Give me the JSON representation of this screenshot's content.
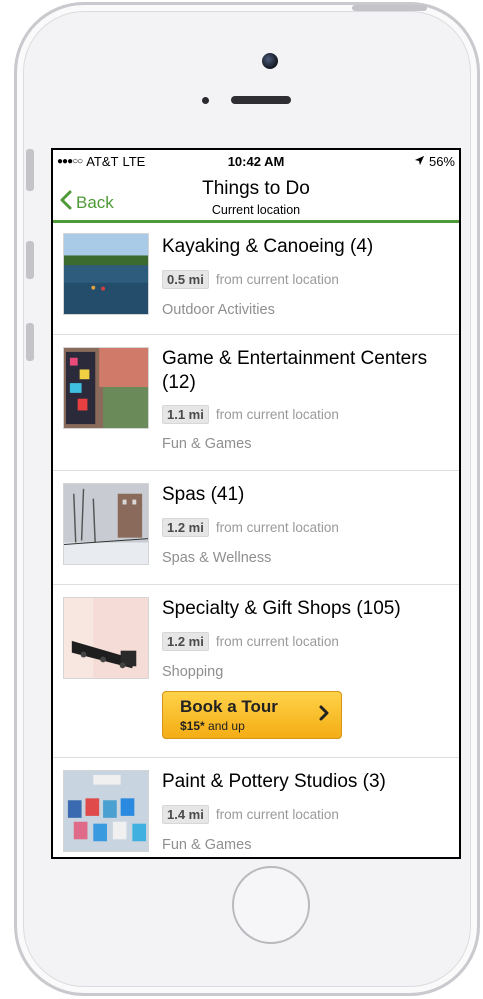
{
  "status_bar": {
    "signal": "●●●○○",
    "carrier": "AT&T",
    "network": "LTE",
    "time": "10:42 AM",
    "battery": "56%",
    "location_icon": "location-arrow-icon",
    "battery_icon": "battery-icon"
  },
  "nav": {
    "back_label": "Back",
    "title": "Things to Do",
    "subtitle": "Current location",
    "accent_color": "#4e9a36"
  },
  "items": [
    {
      "title": "Kayaking & Canoeing (4)",
      "distance": "0.5 mi",
      "distance_suffix": "from current location",
      "category": "Outdoor Activities",
      "thumbnail": "kayaking-photo"
    },
    {
      "title_line1": "Game & Entertainment Centers",
      "title_line2": "(12)",
      "distance": "1.1 mi",
      "distance_suffix": "from current location",
      "category": "Fun & Games",
      "thumbnail": "arcade-photo"
    },
    {
      "title": "Spas (41)",
      "distance": "1.2 mi",
      "distance_suffix": "from current location",
      "category": "Spas & Wellness",
      "thumbnail": "snowy-street-photo"
    },
    {
      "title": "Specialty & Gift Shops (105)",
      "distance": "1.2 mi",
      "distance_suffix": "from current location",
      "category": "Shopping",
      "thumbnail": "toy-train-photo",
      "tour": {
        "title": "Book a Tour",
        "price": "$15*",
        "price_suffix": " and up"
      }
    },
    {
      "title": "Paint & Pottery Studios (3)",
      "distance": "1.4 mi",
      "distance_suffix": "from current location",
      "category": "Fun & Games",
      "thumbnail": "painting-group-photo"
    }
  ]
}
